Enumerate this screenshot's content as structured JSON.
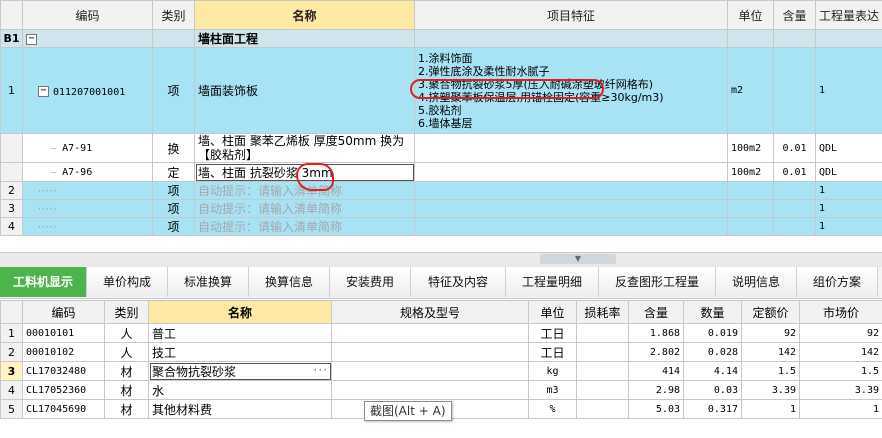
{
  "top_grid": {
    "columns": [
      "编码",
      "类别",
      "名称",
      "项目特征",
      "单位",
      "含量",
      "工程量表达"
    ],
    "section_row": {
      "rownum": "B1",
      "expander": "−",
      "name": "墙柱面工程"
    },
    "item_row": {
      "rownum": "1",
      "expander": "−",
      "code": "011207001001",
      "category": "项",
      "name": "墙面装饰板",
      "features": [
        "1.涂料饰面",
        "2.弹性底涂及柔性耐水腻子",
        "3.聚合物抗裂砂浆5厚(压入耐碱涂塑玻纤网格布)",
        "4.挤塑聚苯板保温层,用锚栓固定(容重≥30kg/m3)",
        "5.胶粘剂",
        "6.墙体基层"
      ],
      "unit": "m2",
      "qty_expr": "1"
    },
    "sub_rows": [
      {
        "code": "A7-91",
        "category": "换",
        "name": "墙、柱面 聚苯乙烯板 厚度50mm  换为【胶粘剂】",
        "unit": "100m2",
        "content": "0.01",
        "qty_expr": "QDL"
      },
      {
        "code": "A7-96",
        "category": "定",
        "name": "墙、柱面 抗裂砂浆 3mm",
        "unit": "100m2",
        "content": "0.01",
        "qty_expr": "QDL"
      }
    ],
    "auto_rows": [
      {
        "rownum": "2",
        "category": "项",
        "hint": "自动提示：请输入清单简称",
        "qty_expr": "1"
      },
      {
        "rownum": "3",
        "category": "项",
        "hint": "自动提示：请输入清单简称",
        "qty_expr": "1"
      },
      {
        "rownum": "4",
        "category": "项",
        "hint": "自动提示：请输入清单简称",
        "qty_expr": "1"
      }
    ]
  },
  "tabs": [
    {
      "label": "工料机显示",
      "active": true
    },
    {
      "label": "单价构成"
    },
    {
      "label": "标准换算"
    },
    {
      "label": "换算信息"
    },
    {
      "label": "安装费用"
    },
    {
      "label": "特征及内容"
    },
    {
      "label": "工程量明细"
    },
    {
      "label": "反查图形工程量"
    },
    {
      "label": "说明信息"
    },
    {
      "label": "组价方案"
    }
  ],
  "bottom_grid": {
    "columns": [
      "编码",
      "类别",
      "名称",
      "规格及型号",
      "单位",
      "损耗率",
      "含量",
      "数量",
      "定额价",
      "市场价"
    ],
    "rows": [
      {
        "rownum": "1",
        "code": "00010101",
        "category": "人",
        "name": "普工",
        "spec": "",
        "unit": "工日",
        "loss": "",
        "content": "1.868",
        "quantity": "0.019",
        "quota_price": "92",
        "market_price": "92"
      },
      {
        "rownum": "2",
        "code": "00010102",
        "category": "人",
        "name": "技工",
        "spec": "",
        "unit": "工日",
        "loss": "",
        "content": "2.802",
        "quantity": "0.028",
        "quota_price": "142",
        "market_price": "142"
      },
      {
        "rownum": "3",
        "code": "CL17032480",
        "category": "材",
        "name": "聚合物抗裂砂浆",
        "spec": "",
        "unit": "kg",
        "loss": "",
        "content": "414",
        "quantity": "4.14",
        "quota_price": "1.5",
        "market_price": "1.5"
      },
      {
        "rownum": "4",
        "code": "CL17052360",
        "category": "材",
        "name": "水",
        "spec": "",
        "unit": "m3",
        "loss": "",
        "content": "2.98",
        "quantity": "0.03",
        "quota_price": "3.39",
        "market_price": "3.39"
      },
      {
        "rownum": "5",
        "code": "CL17045690",
        "category": "材",
        "name": "其他材料费",
        "spec": "",
        "unit": "%",
        "loss": "",
        "content": "5.03",
        "quantity": "0.317",
        "quota_price": "1",
        "market_price": "1"
      }
    ],
    "editing_dots": "···"
  },
  "tooltip": "截图(Alt + A)",
  "colors": {
    "item_row_bg": "#a8e3f5",
    "header_highlight": "#fde9a3",
    "active_tab": "#4db34d",
    "annotation_red": "#e02020"
  }
}
